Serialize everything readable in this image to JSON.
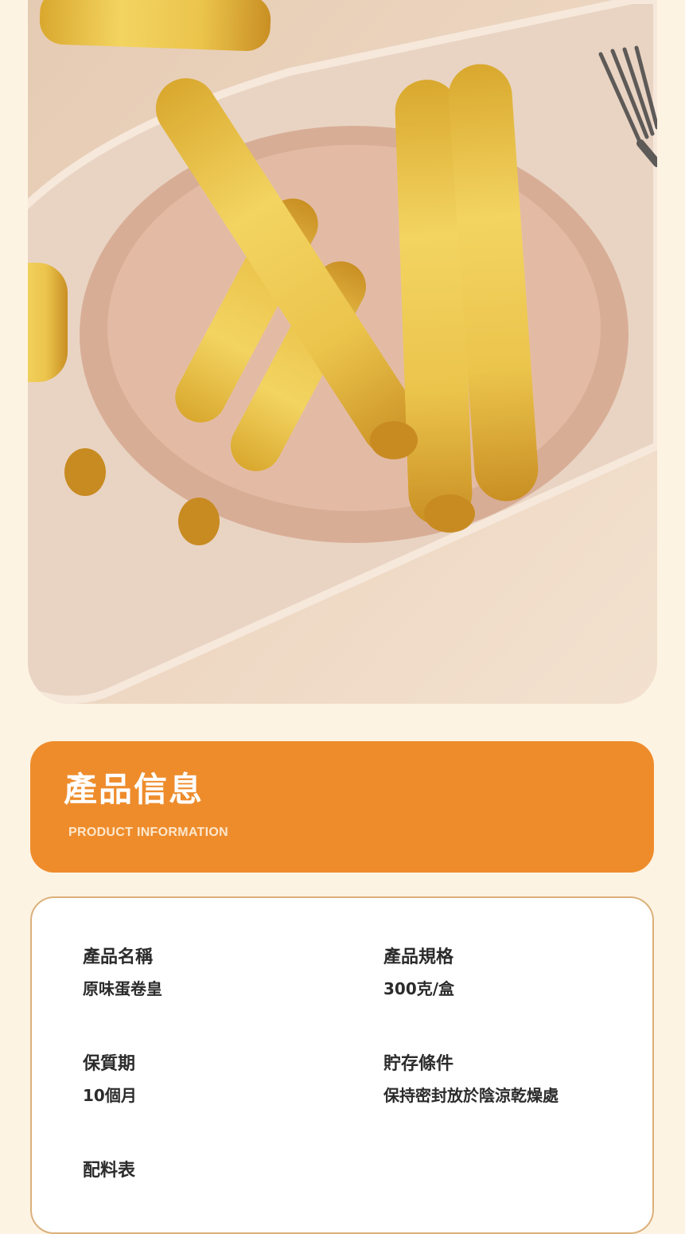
{
  "hero": {
    "image": "egg-roll-cookies-on-plate-photo"
  },
  "banner": {
    "title": "產品信息",
    "subtitle": "PRODUCT INFORMATION",
    "color": "#ee8c2c"
  },
  "info": {
    "name_label": "產品名稱",
    "name_value": "原味蛋卷皇",
    "spec_label": "產品規格",
    "spec_value": "300克/盒",
    "shelf_label": "保質期",
    "shelf_value": "10個月",
    "storage_label": "貯存條件",
    "storage_value": "保持密封放於陰涼乾燥處",
    "ingredients_label": "配料表"
  },
  "colors": {
    "background": "#fdf3e3",
    "accent": "#ee8c2c",
    "card_border": "#dbb07a"
  }
}
